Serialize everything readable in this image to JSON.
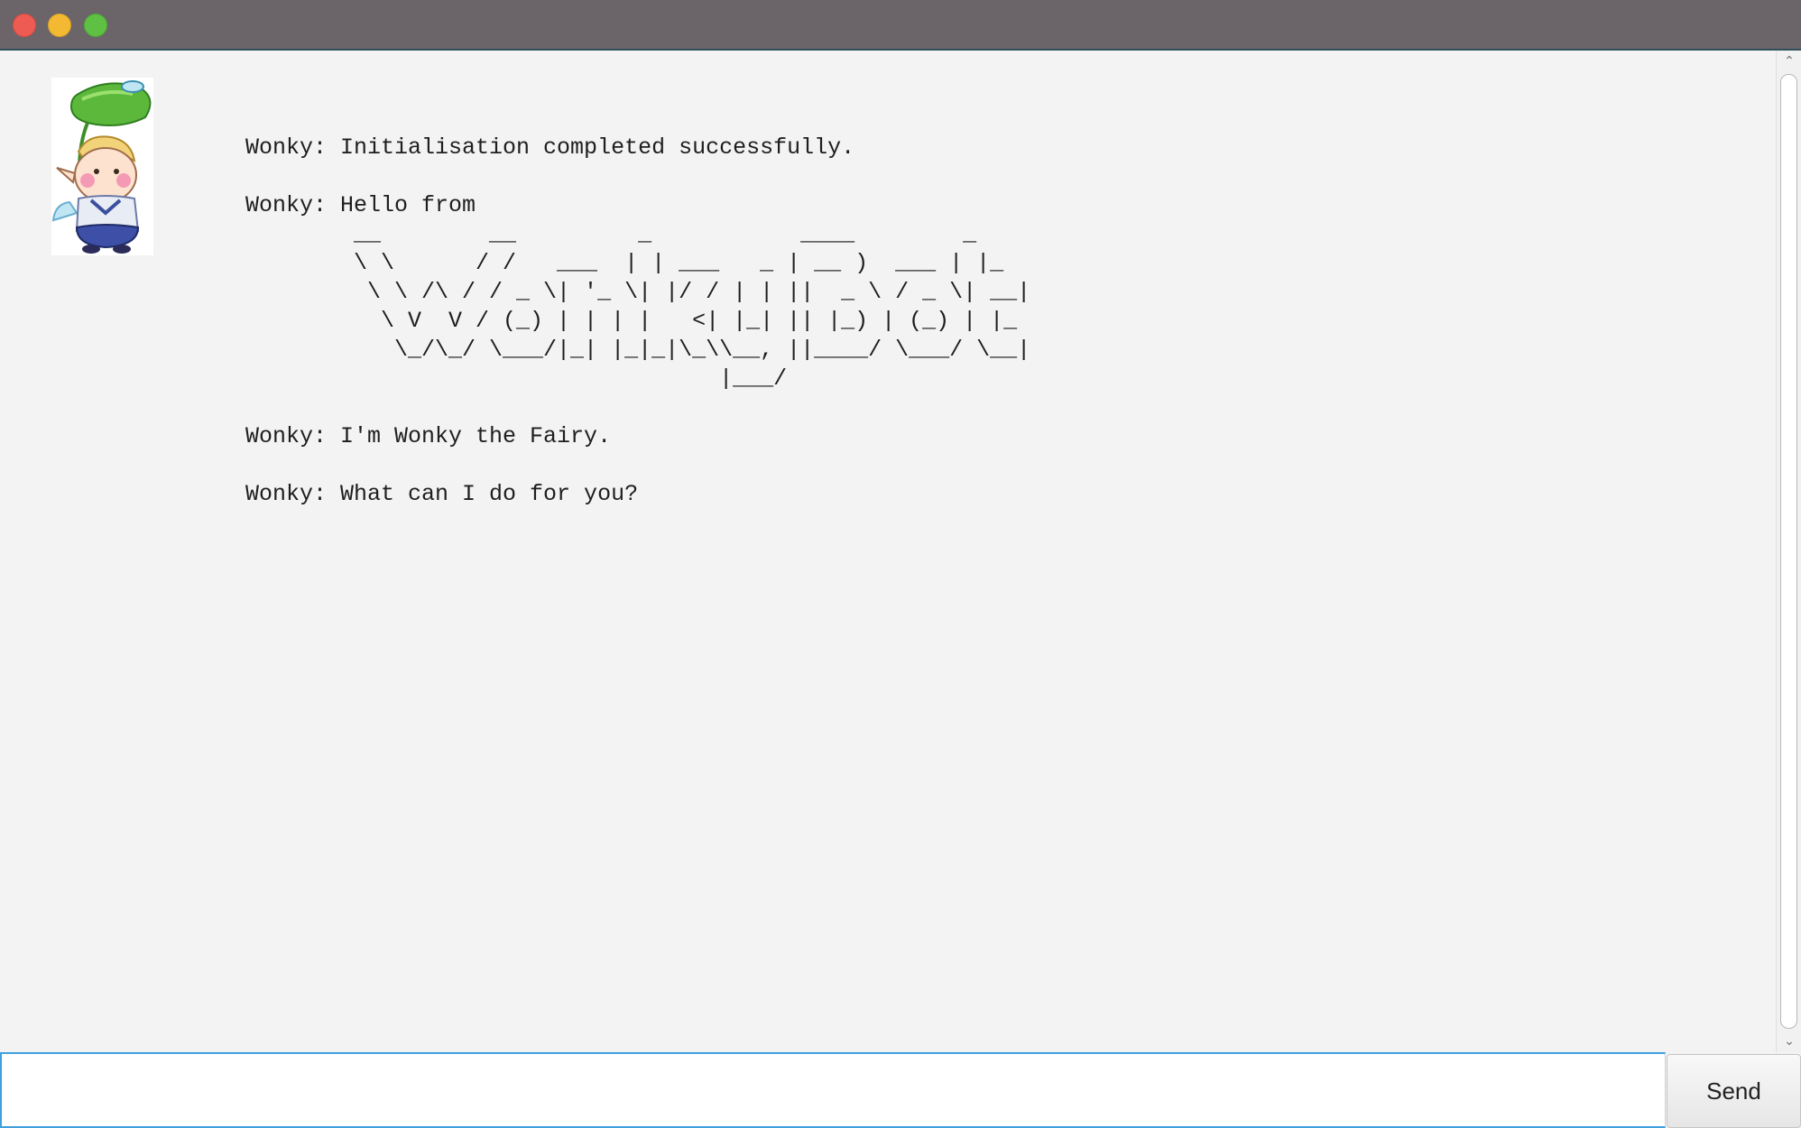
{
  "window": {
    "controls": [
      "close",
      "minimize",
      "maximize"
    ]
  },
  "avatar": {
    "icon": "fairy-avatar-icon"
  },
  "dialog": {
    "messages": [
      "Wonky: Initialisation completed successfully.",
      "Wonky: Hello from",
      "Wonky: I'm Wonky the Fairy.",
      "Wonky: What can I do for you?"
    ],
    "ascii_art": "        __        __         _           ____        _\n        \\ \\      / /   ___  | | ___   _ | __ )  ___ | |_\n         \\ \\ /\\ / / _ \\| '_ \\| |/ / | | ||  _ \\ / _ \\| __|\n          \\ V  V / (_) | | | |   <| |_| || |_) | (_) | |_\n           \\_/\\_/ \\___/|_| |_|_|\\_\\\\__, ||____/ \\___/ \\__|\n                                   |___/"
  },
  "input": {
    "value": "",
    "placeholder": ""
  },
  "send_button": {
    "label": "Send"
  },
  "colors": {
    "titlebar": "#6b6469",
    "background": "#f3f3f3",
    "focus_border": "#3fa0de",
    "text": "#1e1e1e"
  }
}
